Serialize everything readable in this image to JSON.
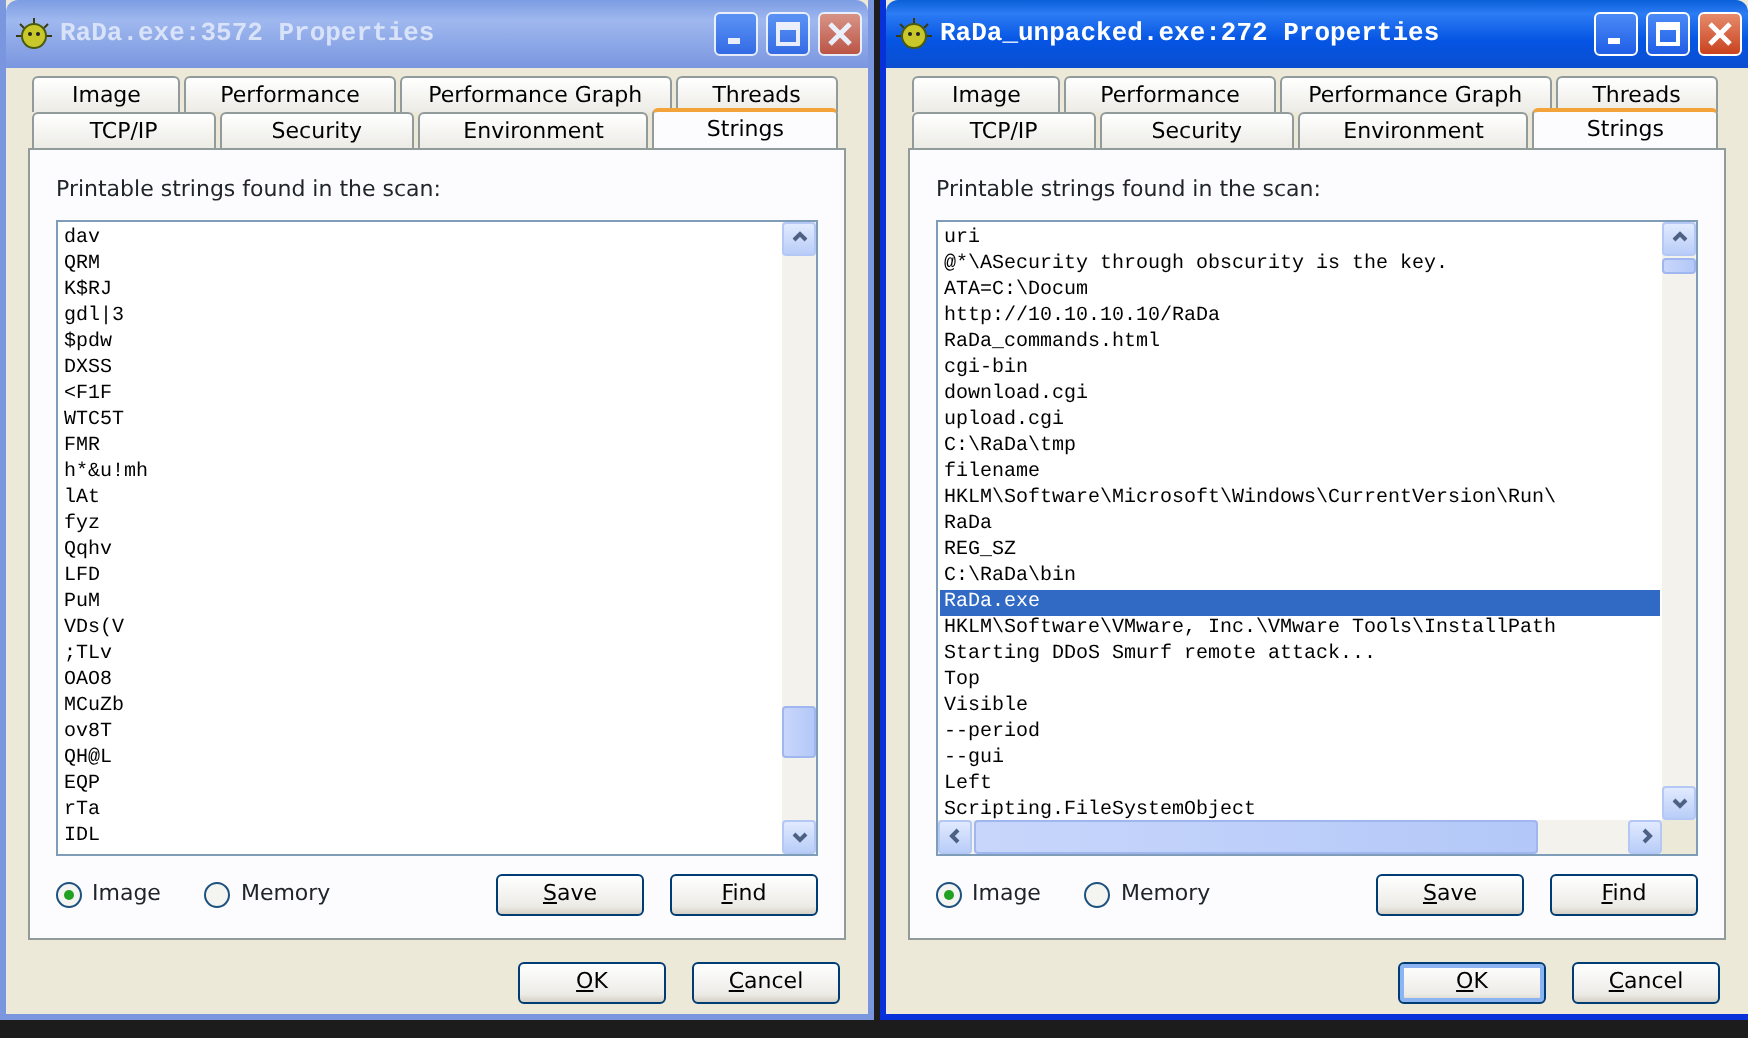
{
  "windows": [
    {
      "title": "RaDa.exe:3572 Properties",
      "active": false,
      "tabs_row_1": [
        {
          "label": "Image",
          "selected": false
        },
        {
          "label": "Performance",
          "selected": false
        },
        {
          "label": "Performance Graph",
          "selected": false
        },
        {
          "label": "Threads",
          "selected": false
        }
      ],
      "tabs_row_2": [
        {
          "label": "TCP/IP",
          "selected": false
        },
        {
          "label": "Security",
          "selected": false
        },
        {
          "label": "Environment",
          "selected": false
        },
        {
          "label": "Strings",
          "selected": true
        }
      ],
      "list_label": "Printable strings found in the scan:",
      "horizontal_scrollbar": false,
      "strings": [
        {
          "text": "dav",
          "selected": false
        },
        {
          "text": "QRM",
          "selected": false
        },
        {
          "text": "K$RJ",
          "selected": false
        },
        {
          "text": "gdl|3",
          "selected": false
        },
        {
          "text": "$pdw",
          "selected": false
        },
        {
          "text": "DXSS",
          "selected": false
        },
        {
          "text": "<F1F",
          "selected": false
        },
        {
          "text": "WTC5T",
          "selected": false
        },
        {
          "text": "FMR",
          "selected": false
        },
        {
          "text": "h*&u!mh",
          "selected": false
        },
        {
          "text": "lAt",
          "selected": false
        },
        {
          "text": "fyz",
          "selected": false
        },
        {
          "text": "Qqhv",
          "selected": false
        },
        {
          "text": "LFD",
          "selected": false
        },
        {
          "text": "PuM",
          "selected": false
        },
        {
          "text": "VDs(V",
          "selected": false
        },
        {
          "text": ";TLv",
          "selected": false
        },
        {
          "text": "OAO8",
          "selected": false
        },
        {
          "text": "MCuZb",
          "selected": false
        },
        {
          "text": "ov8T",
          "selected": false
        },
        {
          "text": "QH@L",
          "selected": false
        },
        {
          "text": "EQP",
          "selected": false
        },
        {
          "text": "rTa",
          "selected": false
        },
        {
          "text": "IDL",
          "selected": false
        }
      ],
      "radios": [
        {
          "label": "Image",
          "selected": true
        },
        {
          "label": "Memory",
          "selected": false
        }
      ],
      "list_buttons": [
        "Save",
        "Find"
      ],
      "dialog_buttons": [
        {
          "label": "OK",
          "focused": false
        },
        {
          "label": "Cancel",
          "focused": false
        }
      ]
    },
    {
      "title": "RaDa_unpacked.exe:272 Properties",
      "active": true,
      "tabs_row_1": [
        {
          "label": "Image",
          "selected": false
        },
        {
          "label": "Performance",
          "selected": false
        },
        {
          "label": "Performance Graph",
          "selected": false
        },
        {
          "label": "Threads",
          "selected": false
        }
      ],
      "tabs_row_2": [
        {
          "label": "TCP/IP",
          "selected": false
        },
        {
          "label": "Security",
          "selected": false
        },
        {
          "label": "Environment",
          "selected": false
        },
        {
          "label": "Strings",
          "selected": true
        }
      ],
      "list_label": "Printable strings found in the scan:",
      "horizontal_scrollbar": true,
      "strings": [
        {
          "text": "uri",
          "selected": false
        },
        {
          "text": "@*\\ASecurity through obscurity is the key.",
          "selected": false
        },
        {
          "text": "ATA=C:\\Docum",
          "selected": false
        },
        {
          "text": "http://10.10.10.10/RaDa",
          "selected": false
        },
        {
          "text": "RaDa_commands.html",
          "selected": false
        },
        {
          "text": "cgi-bin",
          "selected": false
        },
        {
          "text": "download.cgi",
          "selected": false
        },
        {
          "text": "upload.cgi",
          "selected": false
        },
        {
          "text": "C:\\RaDa\\tmp",
          "selected": false
        },
        {
          "text": "filename",
          "selected": false
        },
        {
          "text": "HKLM\\Software\\Microsoft\\Windows\\CurrentVersion\\Run\\",
          "selected": false
        },
        {
          "text": "RaDa",
          "selected": false
        },
        {
          "text": "REG_SZ",
          "selected": false
        },
        {
          "text": "C:\\RaDa\\bin",
          "selected": false
        },
        {
          "text": "RaDa.exe",
          "selected": true
        },
        {
          "text": "HKLM\\Software\\VMware, Inc.\\VMware Tools\\InstallPath",
          "selected": false
        },
        {
          "text": "Starting DDoS Smurf remote attack...",
          "selected": false
        },
        {
          "text": "Top",
          "selected": false
        },
        {
          "text": "Visible",
          "selected": false
        },
        {
          "text": "--period",
          "selected": false
        },
        {
          "text": "--gui",
          "selected": false
        },
        {
          "text": "Left",
          "selected": false
        },
        {
          "text": "Scripting.FileSystemObject",
          "selected": false
        }
      ],
      "radios": [
        {
          "label": "Image",
          "selected": true
        },
        {
          "label": "Memory",
          "selected": false
        }
      ],
      "list_buttons": [
        "Save",
        "Find"
      ],
      "dialog_buttons": [
        {
          "label": "OK",
          "focused": true
        },
        {
          "label": "Cancel",
          "focused": false
        }
      ]
    }
  ]
}
